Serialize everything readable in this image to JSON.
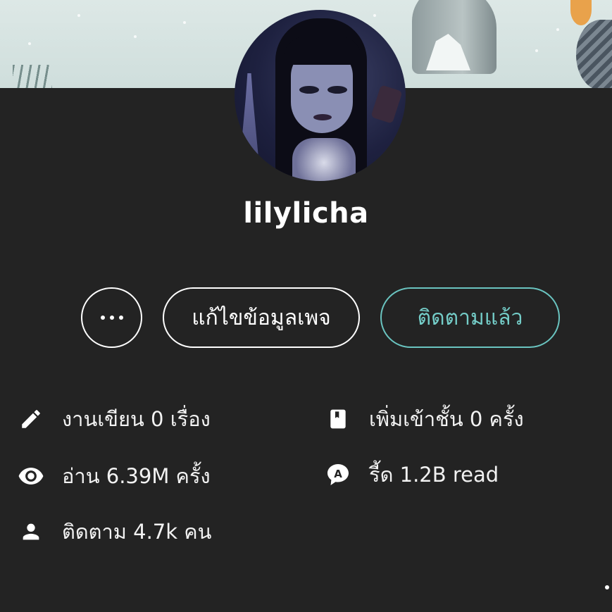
{
  "profile": {
    "username": "lilylicha"
  },
  "actions": {
    "more_label": "",
    "edit_label": "แก้ไขข้อมูลเพจ",
    "follow_label": "ติดตามแล้ว"
  },
  "stats": {
    "works": "งานเขียน 0 เรื่อง",
    "reads": "อ่าน 6.39M ครั้ง",
    "followers": "ติดตาม 4.7k คน",
    "library_adds": "เพิ่มเข้าชั้น 0 ครั้ง",
    "reads_count": "รี้ด 1.2B read"
  },
  "colors": {
    "background": "#232323",
    "accent": "#6ac4c0",
    "text": "#ffffff"
  },
  "icons": {
    "works": "pencil-icon",
    "reads": "eye-icon",
    "followers": "person-icon",
    "library_adds": "bookmark-book-icon",
    "reads_count": "chat-bubble-a-icon",
    "more": "ellipsis-icon"
  }
}
